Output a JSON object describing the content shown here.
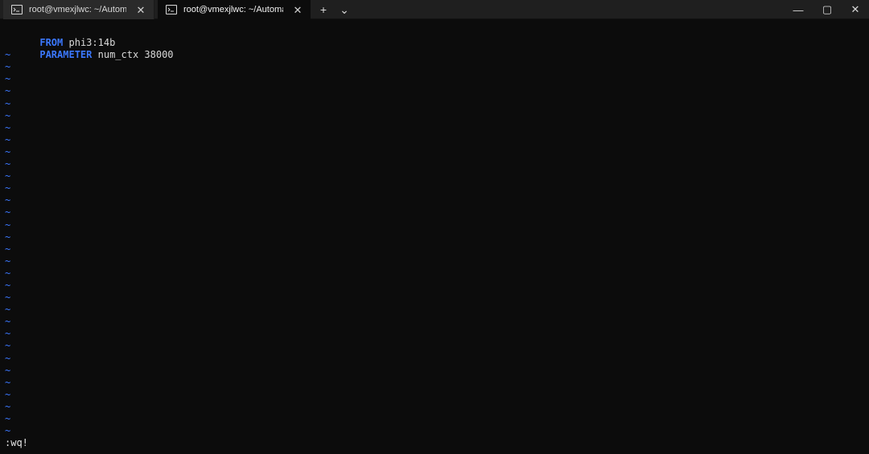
{
  "window": {
    "tabs": [
      {
        "title": "root@vmexjlwc: ~/Automated",
        "close_glyph": "✕",
        "active": false
      },
      {
        "title": "root@vmexjlwc: ~/Automated",
        "close_glyph": "✕",
        "active": true
      }
    ],
    "new_tab_glyph": "+",
    "dropdown_glyph": "⌄",
    "controls": {
      "minimize_glyph": "—",
      "maximize_glyph": "▢",
      "close_glyph": "✕"
    }
  },
  "editor": {
    "lines": [
      {
        "keyword": "FROM",
        "text": " phi3:14b"
      },
      {
        "keyword": "PARAMETER",
        "text": " num_ctx 38000"
      }
    ],
    "empty_line_marker": "~",
    "empty_line_count": 32,
    "command": ":wq!"
  },
  "colors": {
    "titlebar": "#1f1f1f",
    "terminal_background": "#0c0c0c",
    "keyword_blue": "#3b78ff",
    "terminal_text": "#d9d9d9"
  }
}
